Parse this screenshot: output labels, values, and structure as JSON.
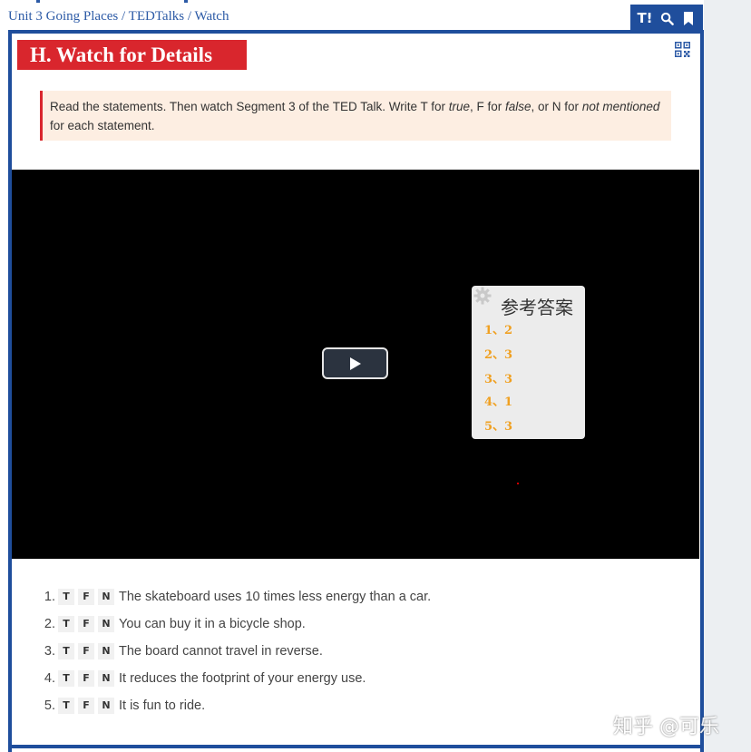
{
  "breadcrumb": {
    "unit": "Unit 3 Going Places",
    "section": "TEDTalks",
    "page": "Watch",
    "separator": "/"
  },
  "toolbar": {
    "font_size_label": "T!",
    "icons": [
      "text-size-icon",
      "search-icon",
      "bookmark-icon"
    ]
  },
  "header": {
    "title": "H. Watch for Details"
  },
  "instructions": {
    "part1": "Read the statements. Then watch Segment 3 of the TED Talk. Write T for ",
    "true_word": "true",
    "part2": ", F for ",
    "false_word": "false",
    "part3": ", or N for ",
    "nm_word": "not mentioned",
    "part4": " for each statement."
  },
  "answer_overlay": {
    "title": "参考答案",
    "items": [
      "1、2",
      "2、3",
      "3、3",
      "4、1",
      "5、3"
    ]
  },
  "questions": [
    {
      "num": "1.",
      "options": [
        "T",
        "F",
        "N"
      ],
      "text": "The skateboard uses 10 times less energy than a car."
    },
    {
      "num": "2.",
      "options": [
        "T",
        "F",
        "N"
      ],
      "text": "You can buy it in a bicycle shop."
    },
    {
      "num": "3.",
      "options": [
        "T",
        "F",
        "N"
      ],
      "text": "The board cannot travel in reverse."
    },
    {
      "num": "4.",
      "options": [
        "T",
        "F",
        "N"
      ],
      "text": "It reduces the footprint of your energy use."
    },
    {
      "num": "5.",
      "options": [
        "T",
        "F",
        "N"
      ],
      "text": "It is fun to ride."
    }
  ],
  "watermark": "知乎 @可乐",
  "colors": {
    "brand_blue": "#1f4e9c",
    "title_red": "#d9262d",
    "instruction_bg": "#fdeee2",
    "answer_orange": "#f0a020"
  }
}
